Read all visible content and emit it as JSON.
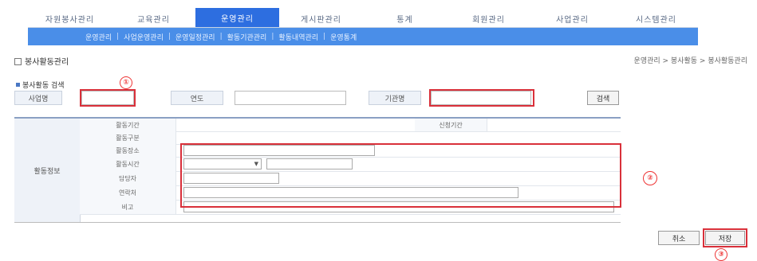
{
  "nav": {
    "tabs": [
      {
        "label": "자원봉사관리"
      },
      {
        "label": "교육관리"
      },
      {
        "label": "운영관리"
      },
      {
        "label": "게시판관리"
      },
      {
        "label": "통계"
      },
      {
        "label": "회원관리"
      },
      {
        "label": "사업관리"
      },
      {
        "label": "시스템관리"
      }
    ],
    "active_index": 2,
    "subtabs": [
      {
        "label": "운영관리"
      },
      {
        "label": "사업운영관리"
      },
      {
        "label": "운영일정관리"
      },
      {
        "label": "활동기관관리"
      },
      {
        "label": "활동내역관리"
      },
      {
        "label": "운영통계"
      }
    ]
  },
  "page": {
    "title": "봉사활동관리",
    "breadcrumb": "운영관리 > 봉사활동 > 봉사활동관리"
  },
  "search": {
    "section_title": "봉사활동 검색",
    "label1": "사업명",
    "value1": "",
    "label2": "연도",
    "value2": "",
    "label3": "기관명",
    "value3": "",
    "search_button": "검색"
  },
  "form": {
    "group_label": "활동정보",
    "rows": [
      {
        "label": "활동기간",
        "value": "",
        "extra_label": "신청기간",
        "extra_value": ""
      },
      {
        "label": "활동구분",
        "value": ""
      },
      {
        "label": "활동장소",
        "value": ""
      },
      {
        "label": "활동시간",
        "select_value": "",
        "mid_value": "",
        "suffix": ""
      },
      {
        "label": "담당자",
        "value": ""
      },
      {
        "label": "연락처",
        "value": ""
      },
      {
        "label": "비고",
        "value": ""
      }
    ]
  },
  "actions": {
    "reset_label": "취소",
    "save_label": "저장"
  },
  "callouts": {
    "c1": "①",
    "c2": "②",
    "c3": "③"
  },
  "colors": {
    "accent": "#2d6ee0",
    "subnav": "#4a8ee8",
    "highlight": "#d9303a"
  }
}
